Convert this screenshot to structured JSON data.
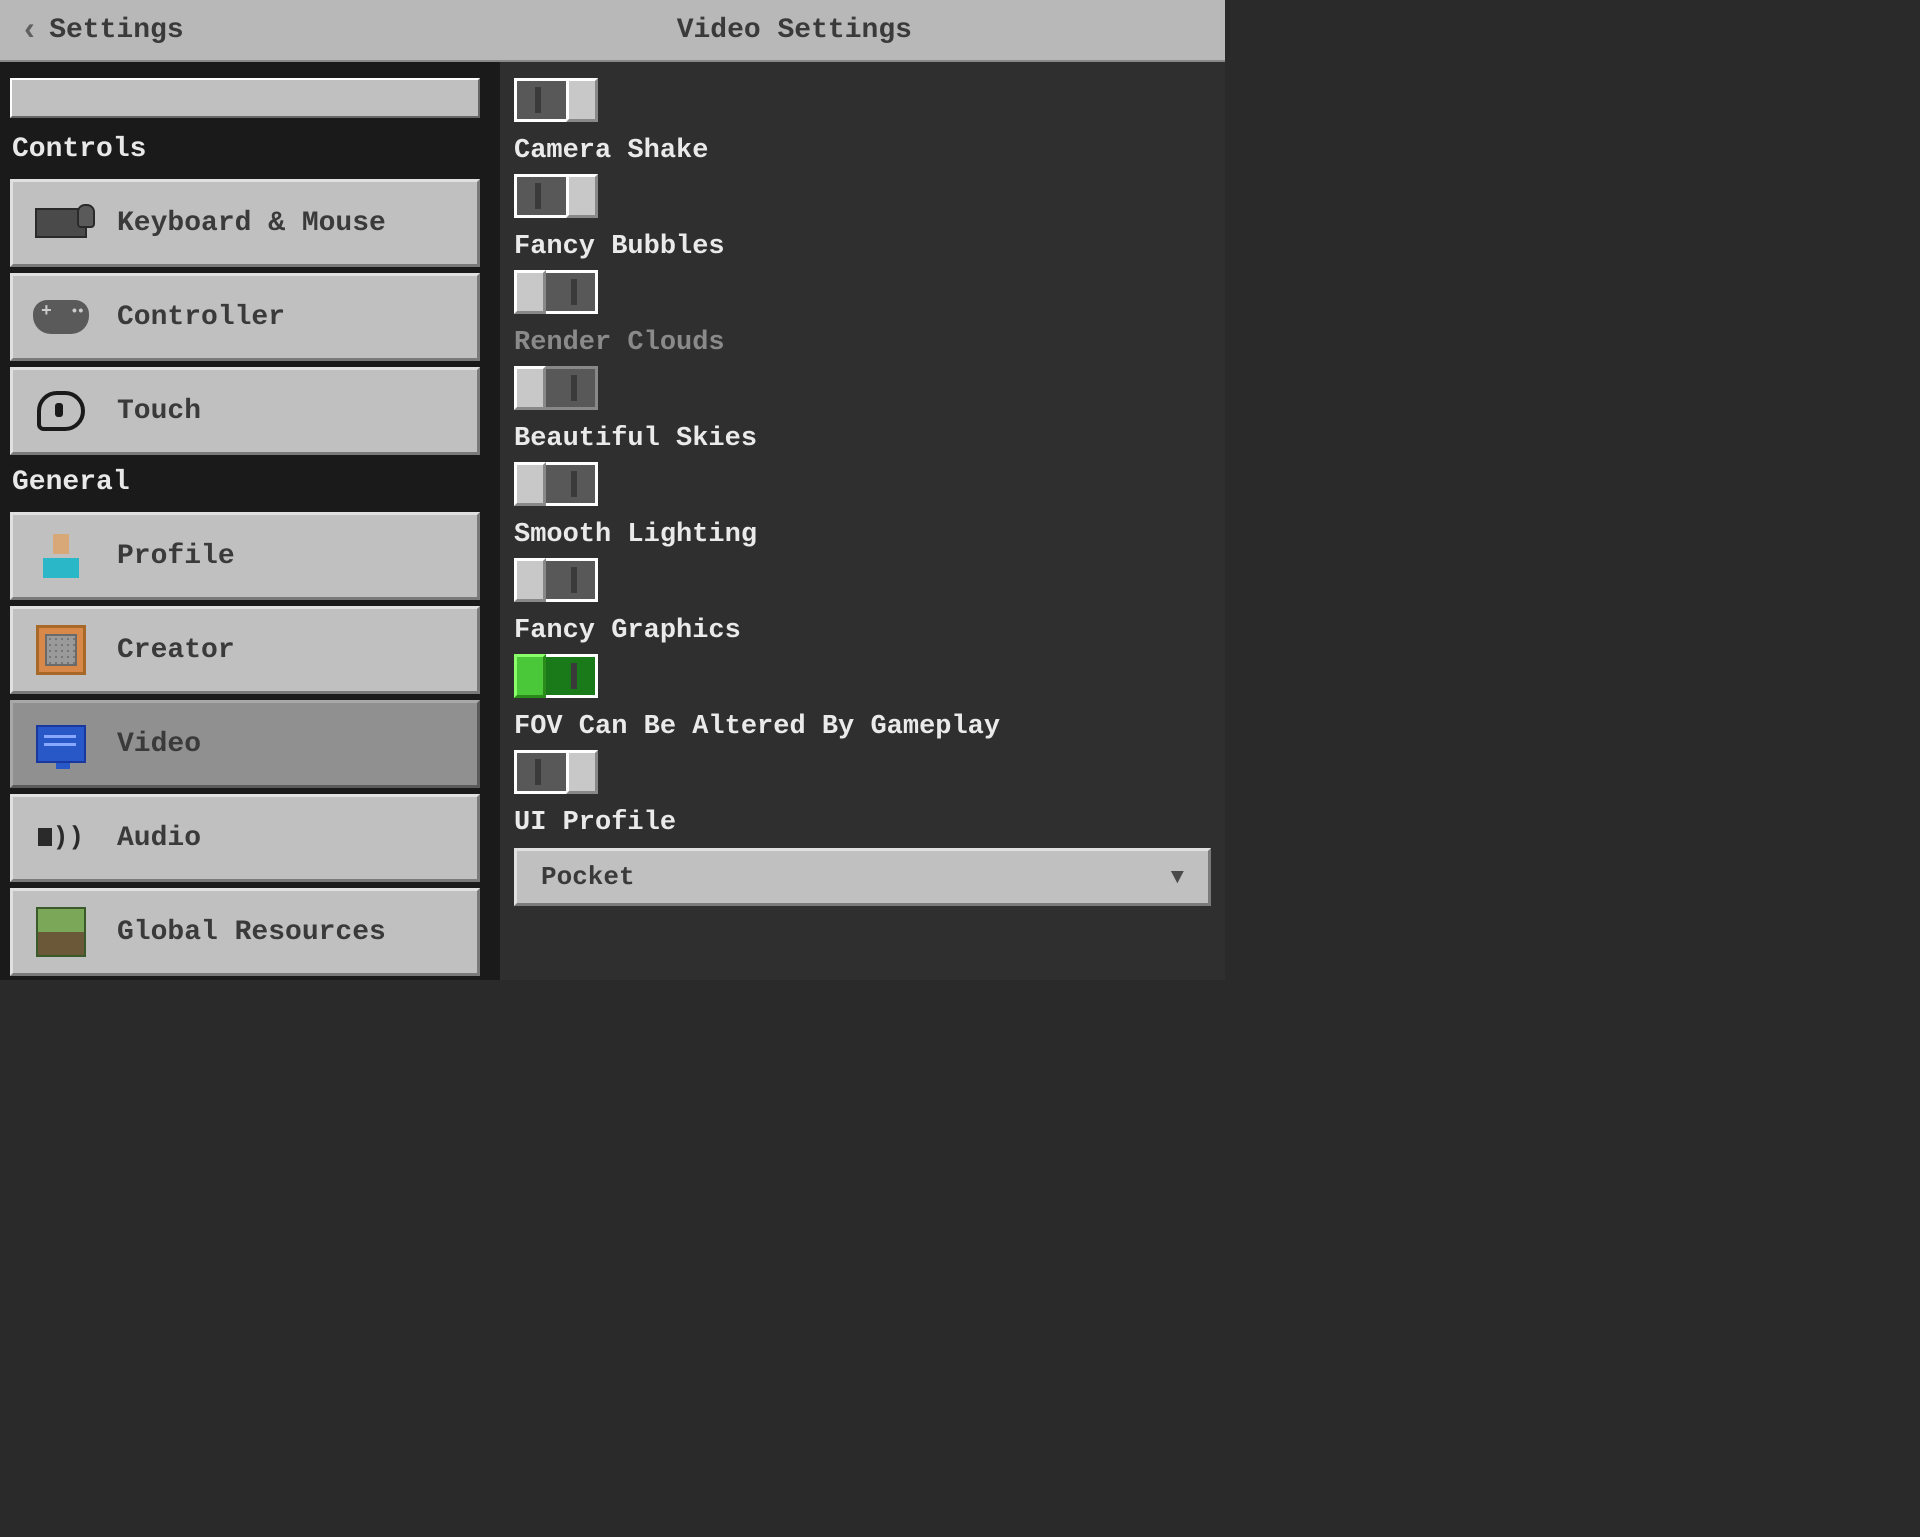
{
  "header": {
    "back_label": "Settings",
    "title": "Video Settings"
  },
  "sidebar": {
    "sections": {
      "controls": {
        "title": "Controls",
        "items": [
          {
            "label": "Keyboard & Mouse"
          },
          {
            "label": "Controller"
          },
          {
            "label": "Touch"
          }
        ]
      },
      "general": {
        "title": "General",
        "items": [
          {
            "label": "Profile"
          },
          {
            "label": "Creator"
          },
          {
            "label": "Video"
          },
          {
            "label": "Audio"
          },
          {
            "label": "Global Resources"
          }
        ]
      }
    }
  },
  "settings": {
    "toggle_partial": {
      "state": "on"
    },
    "camera_shake": {
      "label": "Camera Shake",
      "state": "on"
    },
    "fancy_bubbles": {
      "label": "Fancy Bubbles",
      "state": "off"
    },
    "render_clouds": {
      "label": "Render Clouds",
      "state": "off",
      "disabled": true
    },
    "beautiful_skies": {
      "label": "Beautiful Skies",
      "state": "off"
    },
    "smooth_lighting": {
      "label": "Smooth Lighting",
      "state": "off"
    },
    "fancy_graphics": {
      "label": "Fancy Graphics",
      "state": "off",
      "green": true
    },
    "fov_altered": {
      "label": "FOV Can Be Altered By Gameplay",
      "state": "on"
    },
    "ui_profile": {
      "label": "UI Profile",
      "value": "Pocket"
    }
  }
}
